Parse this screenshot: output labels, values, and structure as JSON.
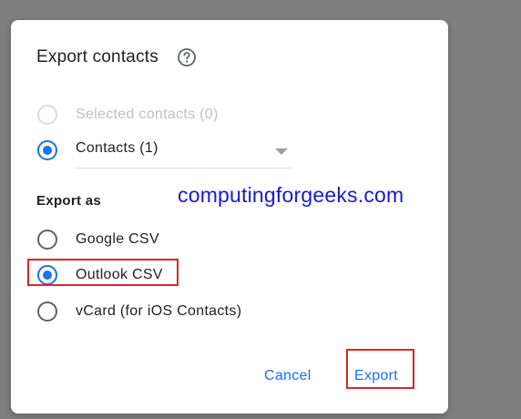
{
  "dialog": {
    "title": "Export contacts",
    "help_icon": "help-circle-icon"
  },
  "contacts_choice": {
    "options": [
      {
        "label": "Selected contacts (0)",
        "selected": false,
        "disabled": true
      },
      {
        "label": "Contacts (1)",
        "selected": true,
        "disabled": false
      }
    ],
    "dropdown_icon": "dropdown-arrow-icon"
  },
  "export_as": {
    "label": "Export as",
    "options": [
      {
        "label": "Google CSV",
        "selected": false
      },
      {
        "label": "Outlook CSV",
        "selected": true
      },
      {
        "label": "vCard (for iOS Contacts)",
        "selected": false
      }
    ]
  },
  "watermark": "computingforgeeks.com",
  "buttons": {
    "cancel": "Cancel",
    "export": "Export"
  },
  "colors": {
    "accent": "#1a73e8",
    "annotation_red": "#d9262c",
    "watermark": "#1a1acc",
    "backdrop": "#7f7f7f"
  }
}
